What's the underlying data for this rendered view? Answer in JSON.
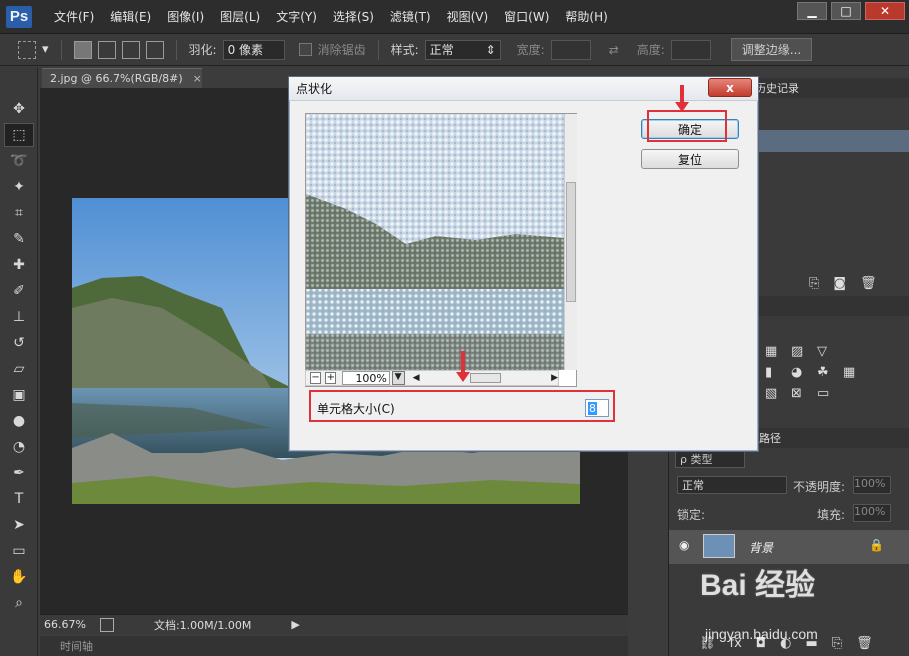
{
  "app": {
    "logo": "Ps",
    "menu": [
      "文件(F)",
      "编辑(E)",
      "图像(I)",
      "图层(L)",
      "文字(Y)",
      "选择(S)",
      "滤镜(T)",
      "视图(V)",
      "窗口(W)",
      "帮助(H)"
    ]
  },
  "options": {
    "feather_label": "羽化:",
    "feather_value": "0 像素",
    "antialias_label": "消除锯齿",
    "style_label": "样式:",
    "style_value": "正常",
    "width_label": "宽度:",
    "height_label": "高度:",
    "refine_label": "调整边缘..."
  },
  "document": {
    "tab_title": "2.jpg @ 66.7%(RGB/8#)",
    "tab_close": "×",
    "zoom": "66.67%",
    "doc_info": "文档:1.00M/1.00M",
    "timeline_label": "时间轴"
  },
  "panels": {
    "history_title": "历史记录",
    "paths_title": "路径",
    "layer_filter": "ρ 类型",
    "blend_mode": "正常",
    "opacity_label": "不透明度:",
    "opacity_value": "100%",
    "lock_label": "锁定:",
    "fill_label": "填充:",
    "fill_value": "100%",
    "layer_name": "背景"
  },
  "dialog": {
    "title": "点状化",
    "close": "x",
    "ok": "确定",
    "reset": "复位",
    "zoom_value": "100%",
    "cell_size_label": "单元格大小(C)",
    "cell_size_value": "8"
  },
  "watermark": {
    "brand": "Bai 经验",
    "url": "jingyan.baidu.com"
  }
}
